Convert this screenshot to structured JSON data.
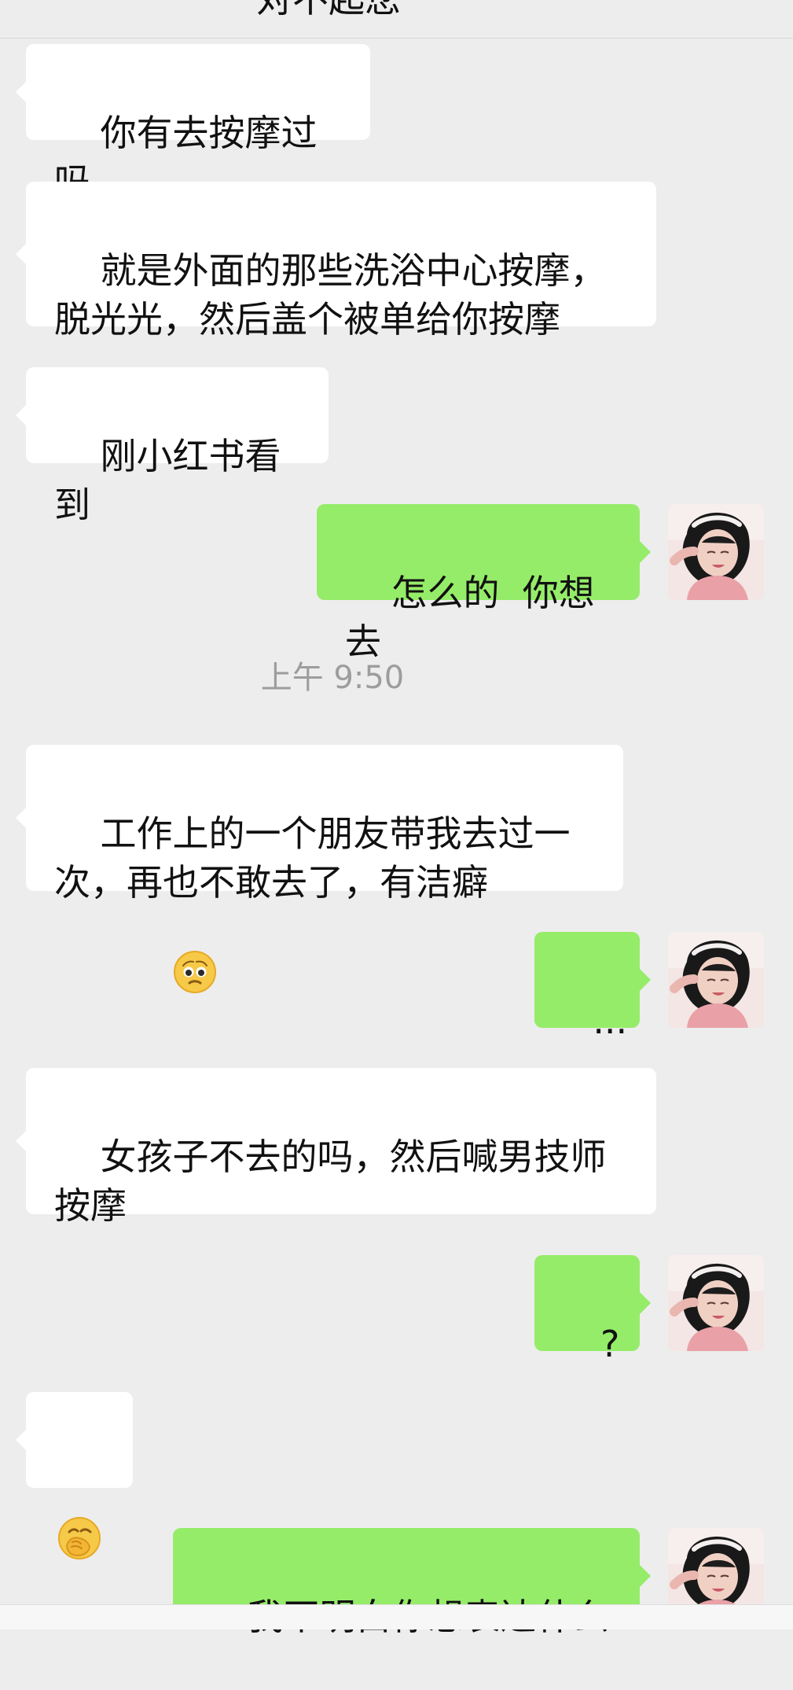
{
  "header": {
    "title": "对不起您"
  },
  "timestamp": "上午 9:50",
  "messages": [
    {
      "text": "你有去按摩过吗"
    },
    {
      "text": "就是外面的那些洗浴中心按摩，\n脱光光，然后盖个被单给你按摩"
    },
    {
      "text": "刚小红书看到"
    },
    {
      "text": "怎么的  你想去"
    },
    {
      "text": "工作上的一个朋友带我去过一\n次，再也不敢去了，有洁癖"
    },
    {
      "text": "..."
    },
    {
      "text": "女孩子不去的吗，然后喊男技师\n按摩"
    },
    {
      "text": "?"
    },
    {
      "text": ""
    },
    {
      "text": "我不明白你想表达什么"
    }
  ],
  "icons": {
    "pleading": "pleading-face-icon",
    "hand_over_mouth": "face-with-hand-over-mouth-icon",
    "avatar": "user-avatar"
  },
  "colors": {
    "incoming_bubble": "#ffffff",
    "outgoing_bubble": "#95ec69",
    "background": "#ededed",
    "timestamp": "#9d9d9d"
  }
}
